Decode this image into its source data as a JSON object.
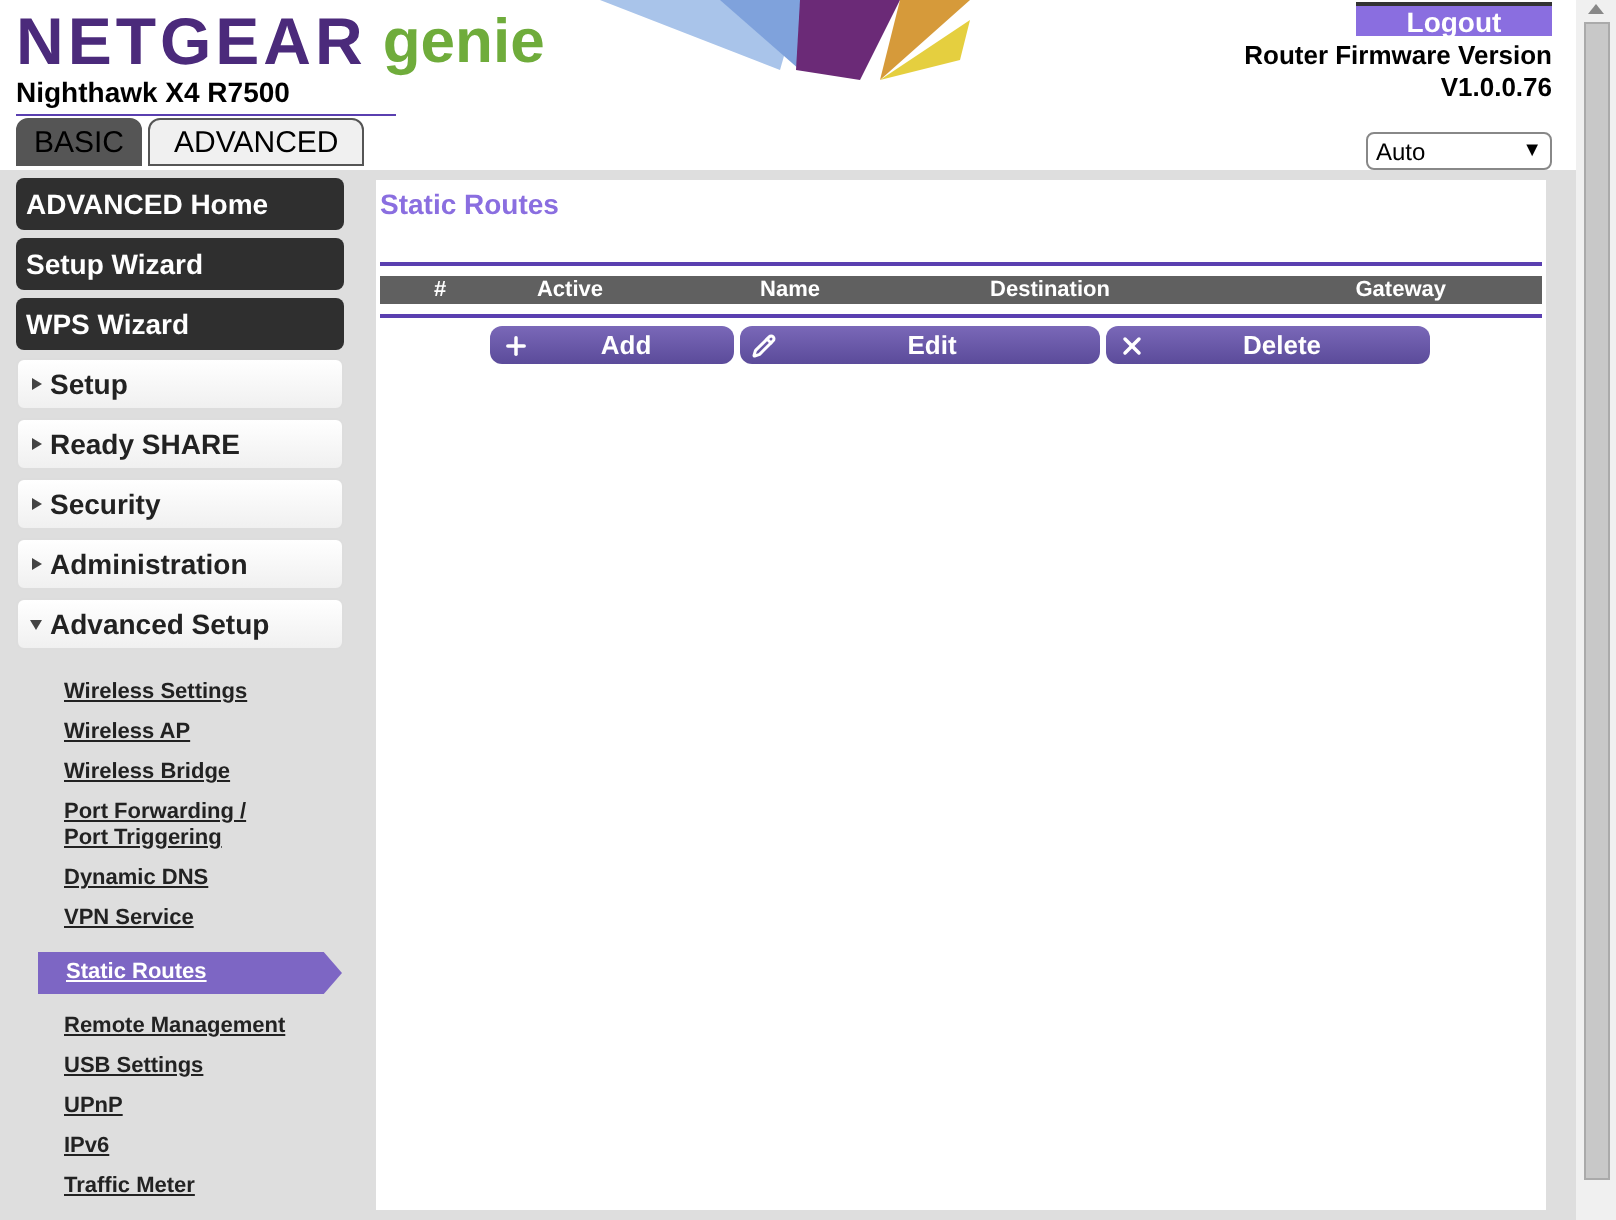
{
  "header": {
    "brand": "NETGEAR",
    "product": "genie",
    "model": "Nighthawk X4 R7500",
    "logout": "Logout",
    "firmware_label": "Router Firmware Version",
    "firmware_version": "V1.0.0.76",
    "language_select": {
      "value": "Auto",
      "arrow": "▼"
    }
  },
  "tabs": [
    {
      "label": "BASIC",
      "selected": false
    },
    {
      "label": "ADVANCED",
      "selected": true
    }
  ],
  "sidebar": {
    "items": [
      {
        "kind": "button",
        "label": "ADVANCED Home"
      },
      {
        "kind": "button",
        "label": "Setup Wizard"
      },
      {
        "kind": "button",
        "label": "WPS Wizard"
      },
      {
        "kind": "section",
        "label": "Setup",
        "expanded": false
      },
      {
        "kind": "section",
        "label": "Ready SHARE",
        "expanded": false
      },
      {
        "kind": "section",
        "label": "Security",
        "expanded": false
      },
      {
        "kind": "section",
        "label": "Administration",
        "expanded": false
      },
      {
        "kind": "section",
        "label": "Advanced Setup",
        "expanded": true,
        "children": [
          {
            "label": "Wireless Settings",
            "selected": false
          },
          {
            "label": "Wireless AP",
            "selected": false
          },
          {
            "label": "Wireless Bridge",
            "selected": false
          },
          {
            "label": "Port Forwarding /\nPort Triggering",
            "selected": false
          },
          {
            "label": "Dynamic DNS",
            "selected": false
          },
          {
            "label": "VPN Service",
            "selected": false
          },
          {
            "label": "Static Routes",
            "selected": true
          },
          {
            "label": "Remote Management",
            "selected": false
          },
          {
            "label": "USB Settings",
            "selected": false
          },
          {
            "label": "UPnP",
            "selected": false
          },
          {
            "label": "IPv6",
            "selected": false
          },
          {
            "label": "Traffic Meter",
            "selected": false
          }
        ]
      }
    ]
  },
  "content": {
    "title": "Static Routes",
    "table": {
      "columns": [
        "#",
        "Active",
        "Name",
        "Destination",
        "Gateway"
      ]
    },
    "buttons": [
      {
        "kind": "add",
        "label": "Add"
      },
      {
        "kind": "edit",
        "label": "Edit"
      },
      {
        "kind": "delete",
        "label": "Delete"
      }
    ]
  }
}
